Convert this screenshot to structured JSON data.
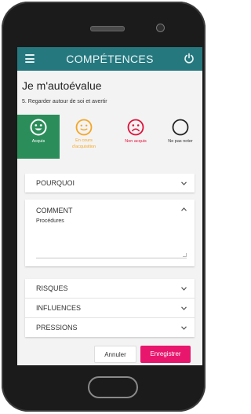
{
  "app_bar": {
    "title": "COMPÉTENCES",
    "menu_icon": "hamburger-menu-icon",
    "power_icon": "power-icon",
    "color": "#26787f"
  },
  "page": {
    "heading": "Je m'autoévalue",
    "question": "5. Regarder autour de soi et avertir"
  },
  "ratings": [
    {
      "label": "Acquis",
      "icon": "smile-face-icon",
      "color": "#2b8e5a",
      "selected": true
    },
    {
      "label_line1": "En cours",
      "label_line2": "d'acquisition",
      "icon": "neutral-smile-face-icon",
      "color": "#f5a623"
    },
    {
      "label": "Non acquis",
      "icon": "sad-face-icon",
      "color": "#e0103a"
    },
    {
      "label": "Ne pas noter",
      "icon": "empty-circle-icon",
      "color": "#222222"
    }
  ],
  "sections": {
    "pourquoi": "POURQUOI",
    "comment": "COMMENT",
    "comment_text": "Procédures",
    "risques": "RISQUES",
    "influences": "INFLUENCES",
    "pressions": "PRESSIONS"
  },
  "buttons": {
    "cancel": "Annuler",
    "save": "Enregistrer",
    "save_color": "#e8166d"
  }
}
